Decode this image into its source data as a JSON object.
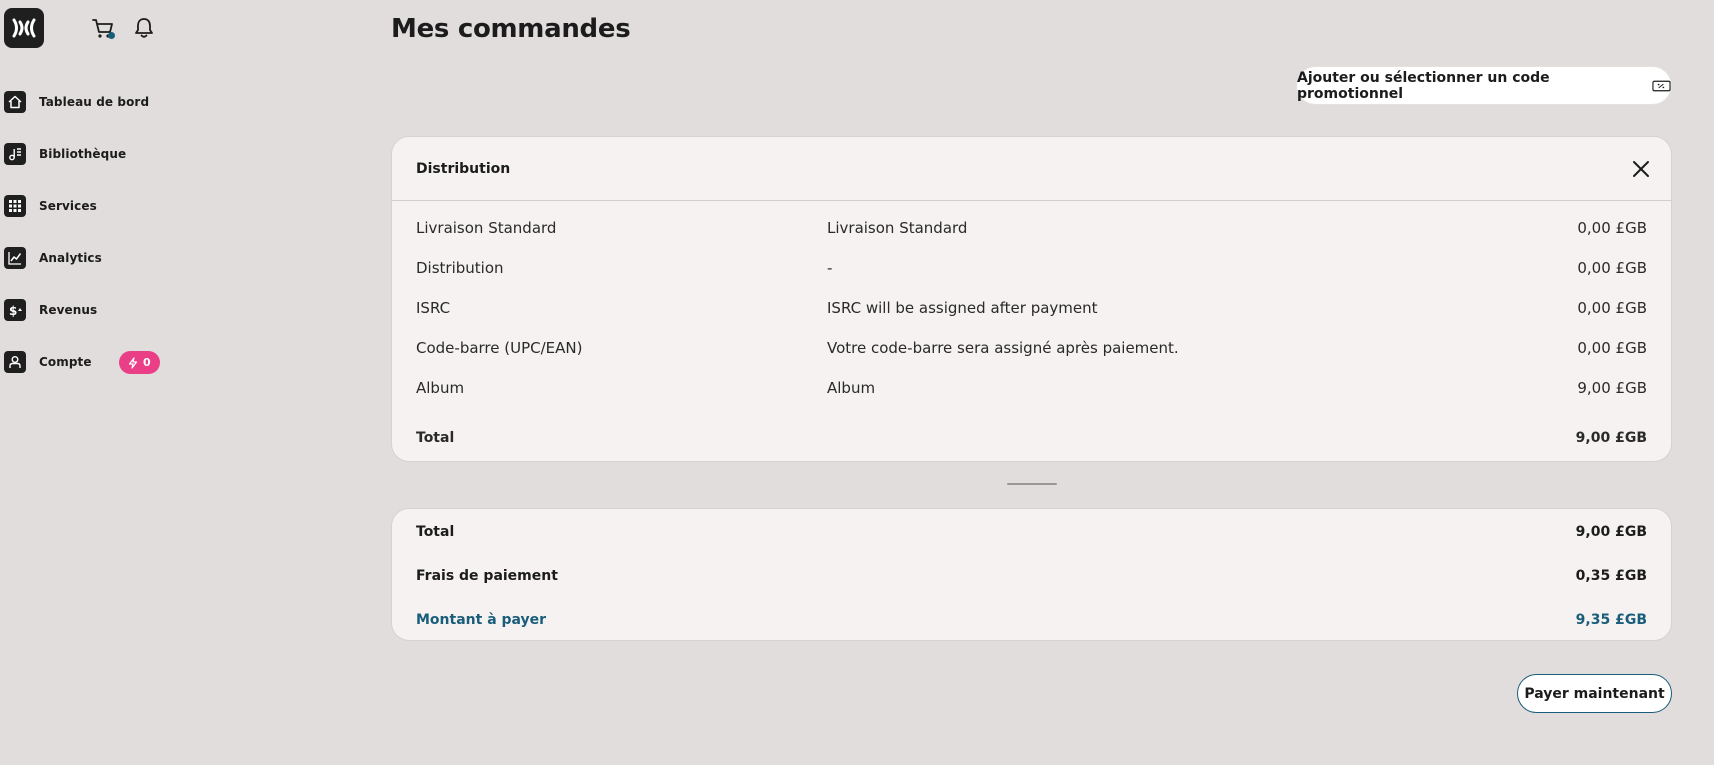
{
  "sidebar": {
    "logo": "brand-logo",
    "items": [
      {
        "label": "Tableau de bord",
        "icon": "home-icon"
      },
      {
        "label": "Bibliothèque",
        "icon": "library-icon"
      },
      {
        "label": "Services",
        "icon": "grid-icon"
      },
      {
        "label": "Analytics",
        "icon": "chart-icon"
      },
      {
        "label": "Revenus",
        "icon": "dollar-icon"
      },
      {
        "label": "Compte",
        "icon": "user-icon",
        "badge": "0"
      }
    ]
  },
  "header": {
    "title": "Mes commandes",
    "promo_button": "Ajouter ou sélectionner un code promotionnel"
  },
  "order": {
    "title": "Distribution",
    "rows": [
      {
        "name": "Livraison Standard",
        "detail": "Livraison Standard",
        "price": "0,00 £GB"
      },
      {
        "name": "Distribution",
        "detail": "-",
        "price": "0,00 £GB"
      },
      {
        "name": "ISRC",
        "detail": "ISRC will be assigned after payment",
        "price": "0,00 £GB"
      },
      {
        "name": "Code-barre (UPC/EAN)",
        "detail": "Votre code-barre sera assigné après paiement.",
        "price": "0,00 £GB"
      },
      {
        "name": "Album",
        "detail": "Album",
        "price": "9,00 £GB"
      }
    ],
    "total_label": "Total",
    "total_value": "9,00 £GB"
  },
  "summary": {
    "total_label": "Total",
    "total_value": "9,00 £GB",
    "fees_label": "Frais de paiement",
    "fees_value": "0,35 £GB",
    "amount_label": "Montant à payer",
    "amount_value": "9,35 £GB"
  },
  "pay_button": "Payer maintenant",
  "colors": {
    "background": "#e0dddc",
    "card": "#f5f2f1",
    "accent": "#1a5d7a",
    "badge": "#ea3f86",
    "icon_dark": "#1f1f1f"
  }
}
